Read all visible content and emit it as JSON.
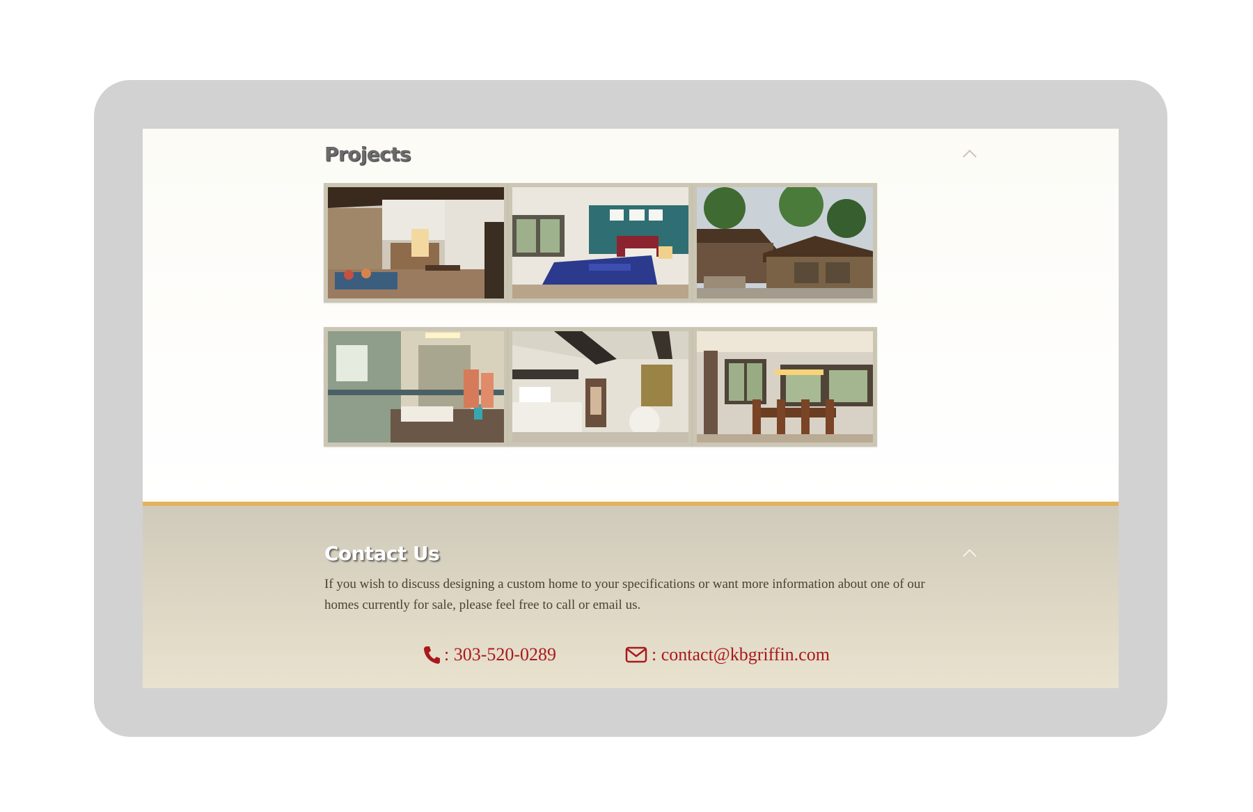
{
  "projects": {
    "title": "Projects",
    "images": [
      {
        "name": "living-room-photo"
      },
      {
        "name": "bedroom-photo"
      },
      {
        "name": "house-exterior-photo"
      },
      {
        "name": "bathroom-photo"
      },
      {
        "name": "hallway-loft-photo"
      },
      {
        "name": "dining-room-photo"
      }
    ]
  },
  "contact": {
    "title": "Contact Us",
    "text": "If you wish to discuss designing a custom home to your specifications or want more information about one of our homes currently for sale, please feel free to call or email us.",
    "phone": ": 303-520-0289",
    "email": ": contact@kbgriffin.com"
  },
  "icons": {
    "section_toggle": "chevron-up-icon",
    "phone": "phone-icon",
    "email": "envelope-icon"
  },
  "colors": {
    "accent_bar": "#e3b35a",
    "link": "#a8191c",
    "frame": "#d2d2d2",
    "thumb_border": "#cbc6b4"
  }
}
